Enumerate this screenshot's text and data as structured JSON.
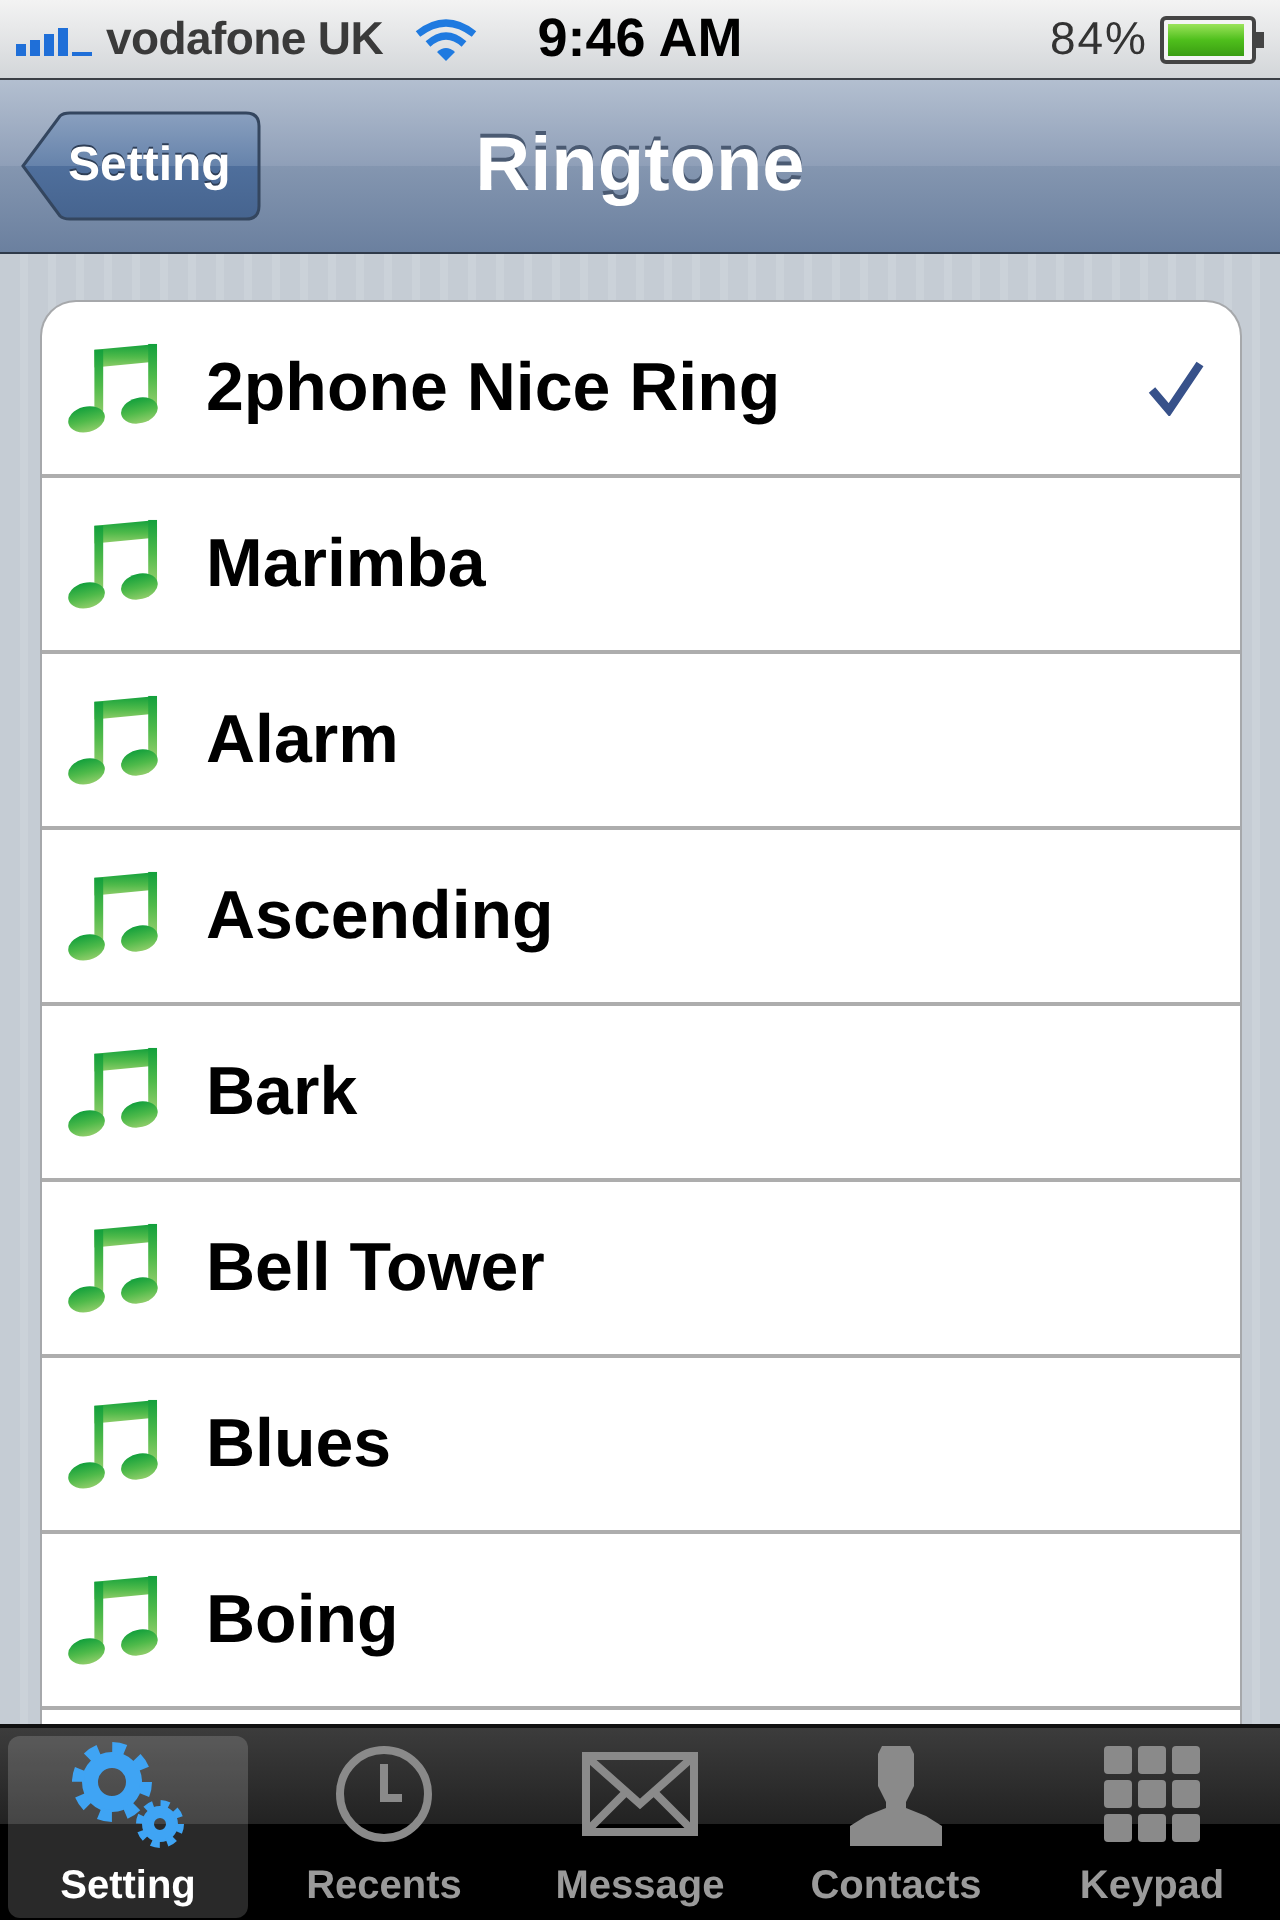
{
  "status_bar": {
    "carrier": "vodafone UK",
    "time": "9:46 AM",
    "battery": "84%"
  },
  "nav_bar": {
    "back_button": "Setting",
    "title": "Ringtone"
  },
  "ringtones": [
    {
      "name": "2phone Nice Ring",
      "selected": true
    },
    {
      "name": "Marimba",
      "selected": false
    },
    {
      "name": "Alarm",
      "selected": false
    },
    {
      "name": "Ascending",
      "selected": false
    },
    {
      "name": "Bark",
      "selected": false
    },
    {
      "name": "Bell Tower",
      "selected": false
    },
    {
      "name": "Blues",
      "selected": false
    },
    {
      "name": "Boing",
      "selected": false
    }
  ],
  "tab_bar": [
    {
      "label": "Setting",
      "kind": "gears",
      "selected": true
    },
    {
      "label": "Recents",
      "kind": "clock",
      "selected": false
    },
    {
      "label": "Message",
      "kind": "envelope",
      "selected": false
    },
    {
      "label": "Contacts",
      "kind": "person",
      "selected": false
    },
    {
      "label": "Keypad",
      "kind": "keypad",
      "selected": false
    }
  ]
}
